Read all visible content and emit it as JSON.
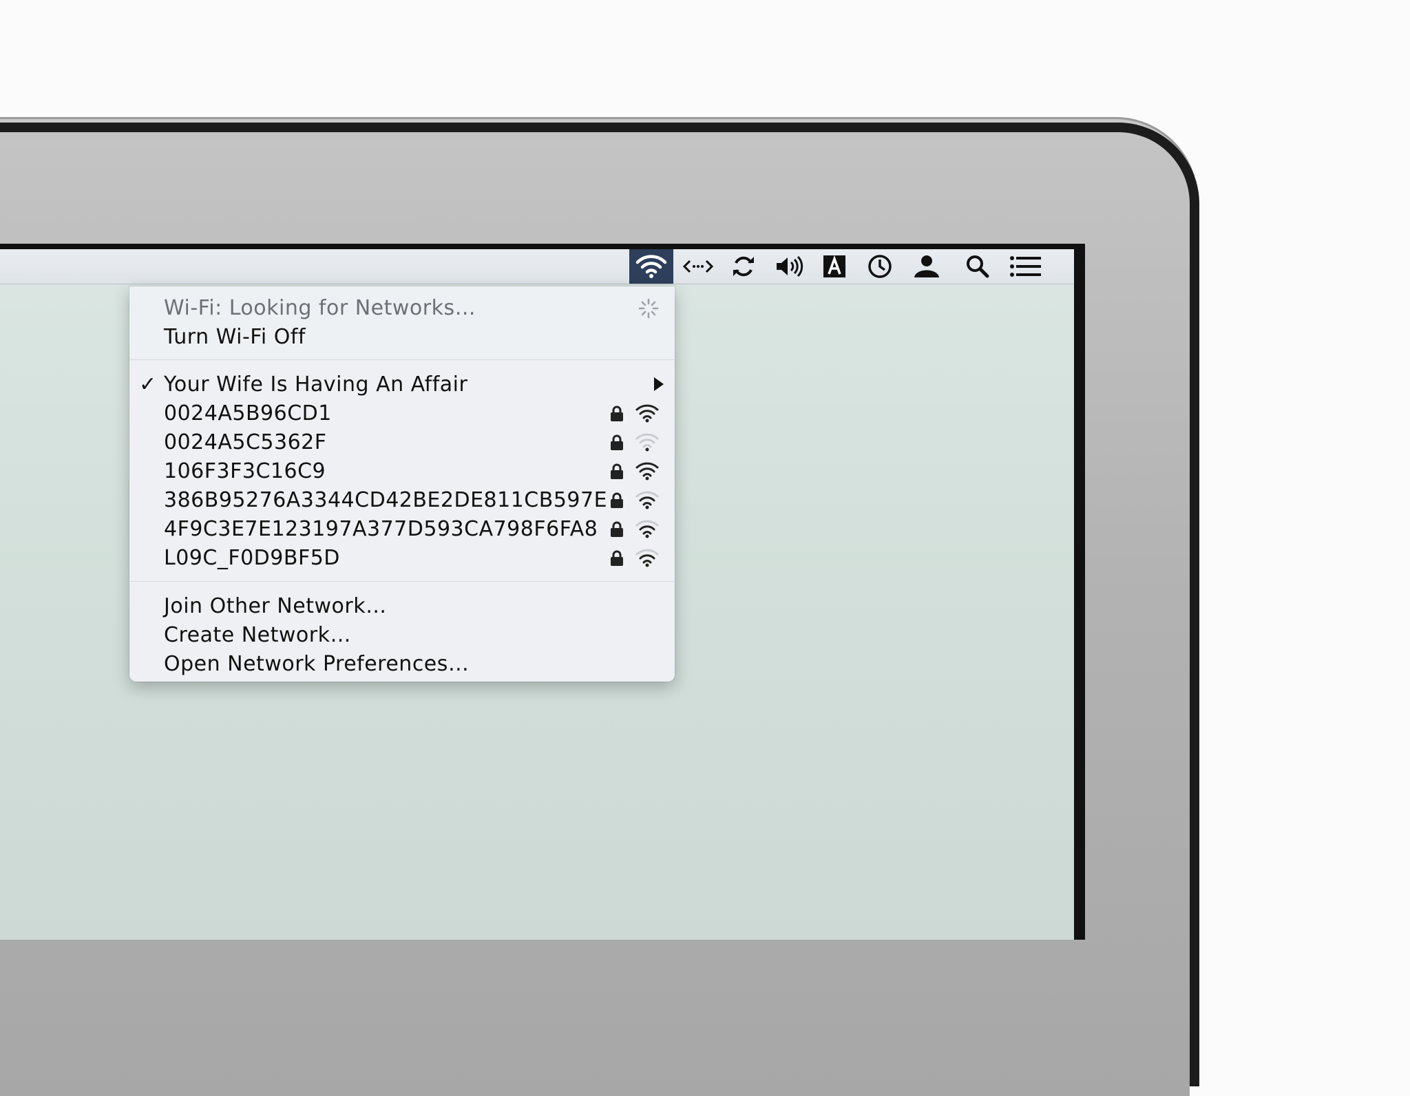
{
  "menubar": {
    "icons": [
      {
        "name": "wifi-icon",
        "active": true
      },
      {
        "name": "network-arrows-icon",
        "glyph": "<··>"
      },
      {
        "name": "sync-icon",
        "glyph": "⟳"
      },
      {
        "name": "volume-icon"
      },
      {
        "name": "input-source-icon",
        "glyph": "A"
      },
      {
        "name": "time-machine-icon"
      },
      {
        "name": "user-icon"
      },
      {
        "name": "spotlight-icon"
      },
      {
        "name": "notification-center-icon"
      }
    ]
  },
  "wifi_menu": {
    "status": "Wi-Fi: Looking for Networks…",
    "toggle": "Turn Wi-Fi Off",
    "networks": [
      {
        "ssid": "Your Wife Is Having An Affair",
        "connected": true,
        "submenu": true
      },
      {
        "ssid": "0024A5B96CD1",
        "locked": true,
        "strength": 4
      },
      {
        "ssid": "0024A5C5362F",
        "locked": true,
        "strength": 1
      },
      {
        "ssid": "106F3F3C16C9",
        "locked": true,
        "strength": 4
      },
      {
        "ssid": "386B95276A3344CD42BE2DE811CB597E",
        "locked": true,
        "strength": 2
      },
      {
        "ssid": "4F9C3E7E123197A377D593CA798F6FA8",
        "locked": true,
        "strength": 3
      },
      {
        "ssid": "L09C_F0D9BF5D",
        "locked": true,
        "strength": 3
      }
    ],
    "actions": {
      "join": "Join Other Network…",
      "create": "Create Network…",
      "preferences": "Open Network Preferences…"
    }
  },
  "colors": {
    "menubar_active": "#2d3f5a",
    "menu_bg": "#eef1f4",
    "disabled_text": "#6c7077"
  }
}
